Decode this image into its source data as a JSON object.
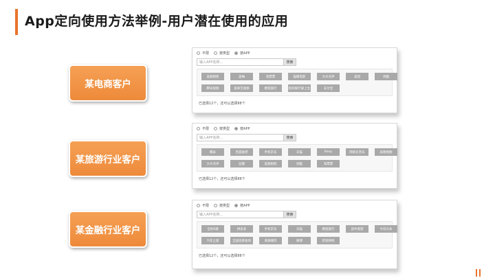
{
  "slide": {
    "title": "App定向使用方法举例-用户潜在使用的应用",
    "accent_color": "#e8742c"
  },
  "clients": [
    {
      "label": "某电商客户"
    },
    {
      "label": "某旅游行业客户"
    },
    {
      "label": "某金融行业客户"
    }
  ],
  "panels": [
    {
      "radios": [
        "不限",
        "按类型",
        "按APP"
      ],
      "selected_radio": 2,
      "search_placeholder": "输入APP名称...",
      "search_button": "搜索",
      "tags": [
        "美丽相机",
        "美柚",
        "淘票票",
        "猫眼电影",
        "大众点评",
        "美团",
        "优酷",
        "腾讯视频",
        "爱奇艺视频",
        "携程旅行",
        "招商银行掌上生",
        "支付宝"
      ],
      "status": "已选择12个，还可以选择88个"
    },
    {
      "radios": [
        "不限",
        "按类型",
        "按APP"
      ],
      "selected_radio": 2,
      "search_placeholder": "输入APP名称...",
      "search_button": "搜索",
      "tags": [
        "糯米",
        "百度贴吧",
        "手机京东",
        "天猫",
        "Keep",
        "网易云音乐",
        "高德地图",
        "大众点评",
        "豆瓣",
        "美丽相机",
        "优酷",
        "淘票票"
      ],
      "status": "已选择12个，还可以选择88个"
    },
    {
      "radios": [
        "不限",
        "按类型",
        "按APP"
      ],
      "selected_radio": 2,
      "search_placeholder": "输入APP名称...",
      "search_button": "搜索",
      "tags": [
        "全民K歌",
        "拼多多",
        "手机京东",
        "天猫",
        "携程旅行",
        "途牛旅游",
        "今日头条",
        "汽车之家",
        "全国违章查询",
        "滴滴顺风",
        "微博",
        "新浪财经"
      ],
      "status": "已选择12个，还可以选择88个"
    }
  ]
}
